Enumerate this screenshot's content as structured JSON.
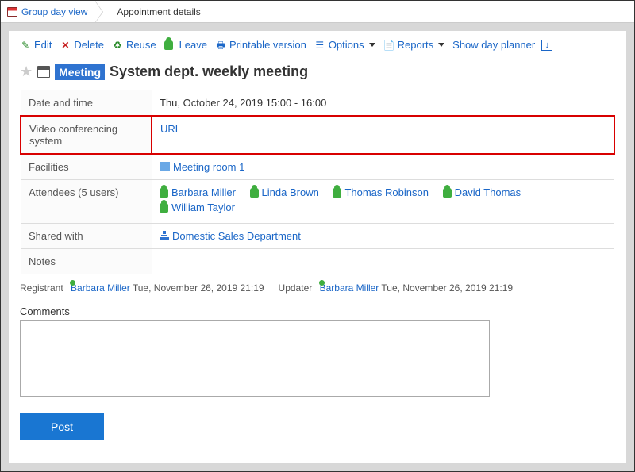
{
  "breadcrumb": {
    "back": "Group day view",
    "current": "Appointment details"
  },
  "toolbar": {
    "edit": "Edit",
    "delete": "Delete",
    "reuse": "Reuse",
    "leave": "Leave",
    "print": "Printable version",
    "options": "Options",
    "reports": "Reports",
    "show_day_planner": "Show day planner"
  },
  "title": {
    "badge": "Meeting",
    "text": "System dept. weekly meeting"
  },
  "rows": {
    "datetime_label": "Date and time",
    "datetime_value": "Thu, October 24, 2019   15:00  -  16:00",
    "vc_label": "Video conferencing system",
    "vc_value": "URL",
    "facilities_label": "Facilities",
    "facilities_value": "Meeting room 1",
    "attendees_label": "Attendees (5 users)",
    "attendees": [
      "Barbara Miller",
      "Linda Brown",
      "Thomas Robinson",
      "David Thomas",
      "William Taylor"
    ],
    "shared_label": "Shared with",
    "shared_value": "Domestic Sales Department",
    "notes_label": "Notes"
  },
  "meta": {
    "registrant_label": "Registrant",
    "registrant_user": "Barbara Miller",
    "registrant_time": "Tue, November 26, 2019 21:19",
    "updater_label": "Updater",
    "updater_user": "Barbara Miller",
    "updater_time": "Tue, November 26, 2019 21:19"
  },
  "comments": {
    "label": "Comments",
    "value": "",
    "post": "Post"
  }
}
